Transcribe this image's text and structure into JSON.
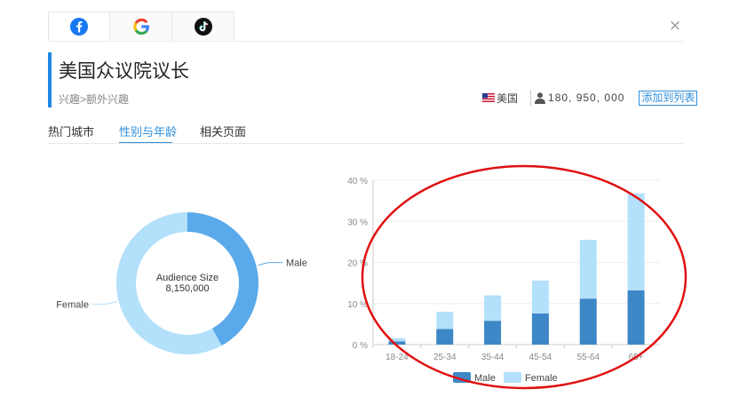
{
  "social_tabs": [
    {
      "icon": "facebook-icon",
      "active": true
    },
    {
      "icon": "google-icon",
      "active": false
    },
    {
      "icon": "tiktok-icon",
      "active": false
    }
  ],
  "close_label": "×",
  "header": {
    "title": "美国众议院议长",
    "breadcrumb": "兴趣>额外兴趣",
    "country": "美国",
    "audience_size": "180, 950, 000",
    "add_list_label": "添加到列表"
  },
  "sub_tabs": [
    {
      "label": "热门城市",
      "active": false
    },
    {
      "label": "性别与年龄",
      "active": true
    },
    {
      "label": "相关页面",
      "active": false
    }
  ],
  "colors": {
    "accent": "#2f8fdc",
    "male_donut": "#5aa9ea",
    "female_donut": "#b3e0fb",
    "male_bar": "#3d87c7",
    "female_bar": "#b3e0fb",
    "annotation": "#e01010"
  },
  "chart_data": [
    {
      "type": "pie",
      "variant": "donut",
      "center_title": "Audience Size",
      "center_value": "8,150,000",
      "slices": [
        {
          "name": "Male",
          "value": 42
        },
        {
          "name": "Female",
          "value": 58
        }
      ]
    },
    {
      "type": "bar",
      "stacked": true,
      "categories": [
        "18-24",
        "25-34",
        "35-44",
        "45-54",
        "55-64",
        "65+"
      ],
      "series": [
        {
          "name": "Male",
          "values": [
            0.8,
            3.8,
            5.8,
            7.6,
            11.2,
            13.2
          ]
        },
        {
          "name": "Female",
          "values": [
            0.8,
            4.2,
            6.2,
            8.0,
            14.3,
            23.6
          ]
        }
      ],
      "yticks": [
        "0 %",
        "10 %",
        "20 %",
        "30 %",
        "40 %"
      ],
      "ylim": [
        0,
        40
      ],
      "grid": true,
      "legend_position": "bottom"
    }
  ]
}
